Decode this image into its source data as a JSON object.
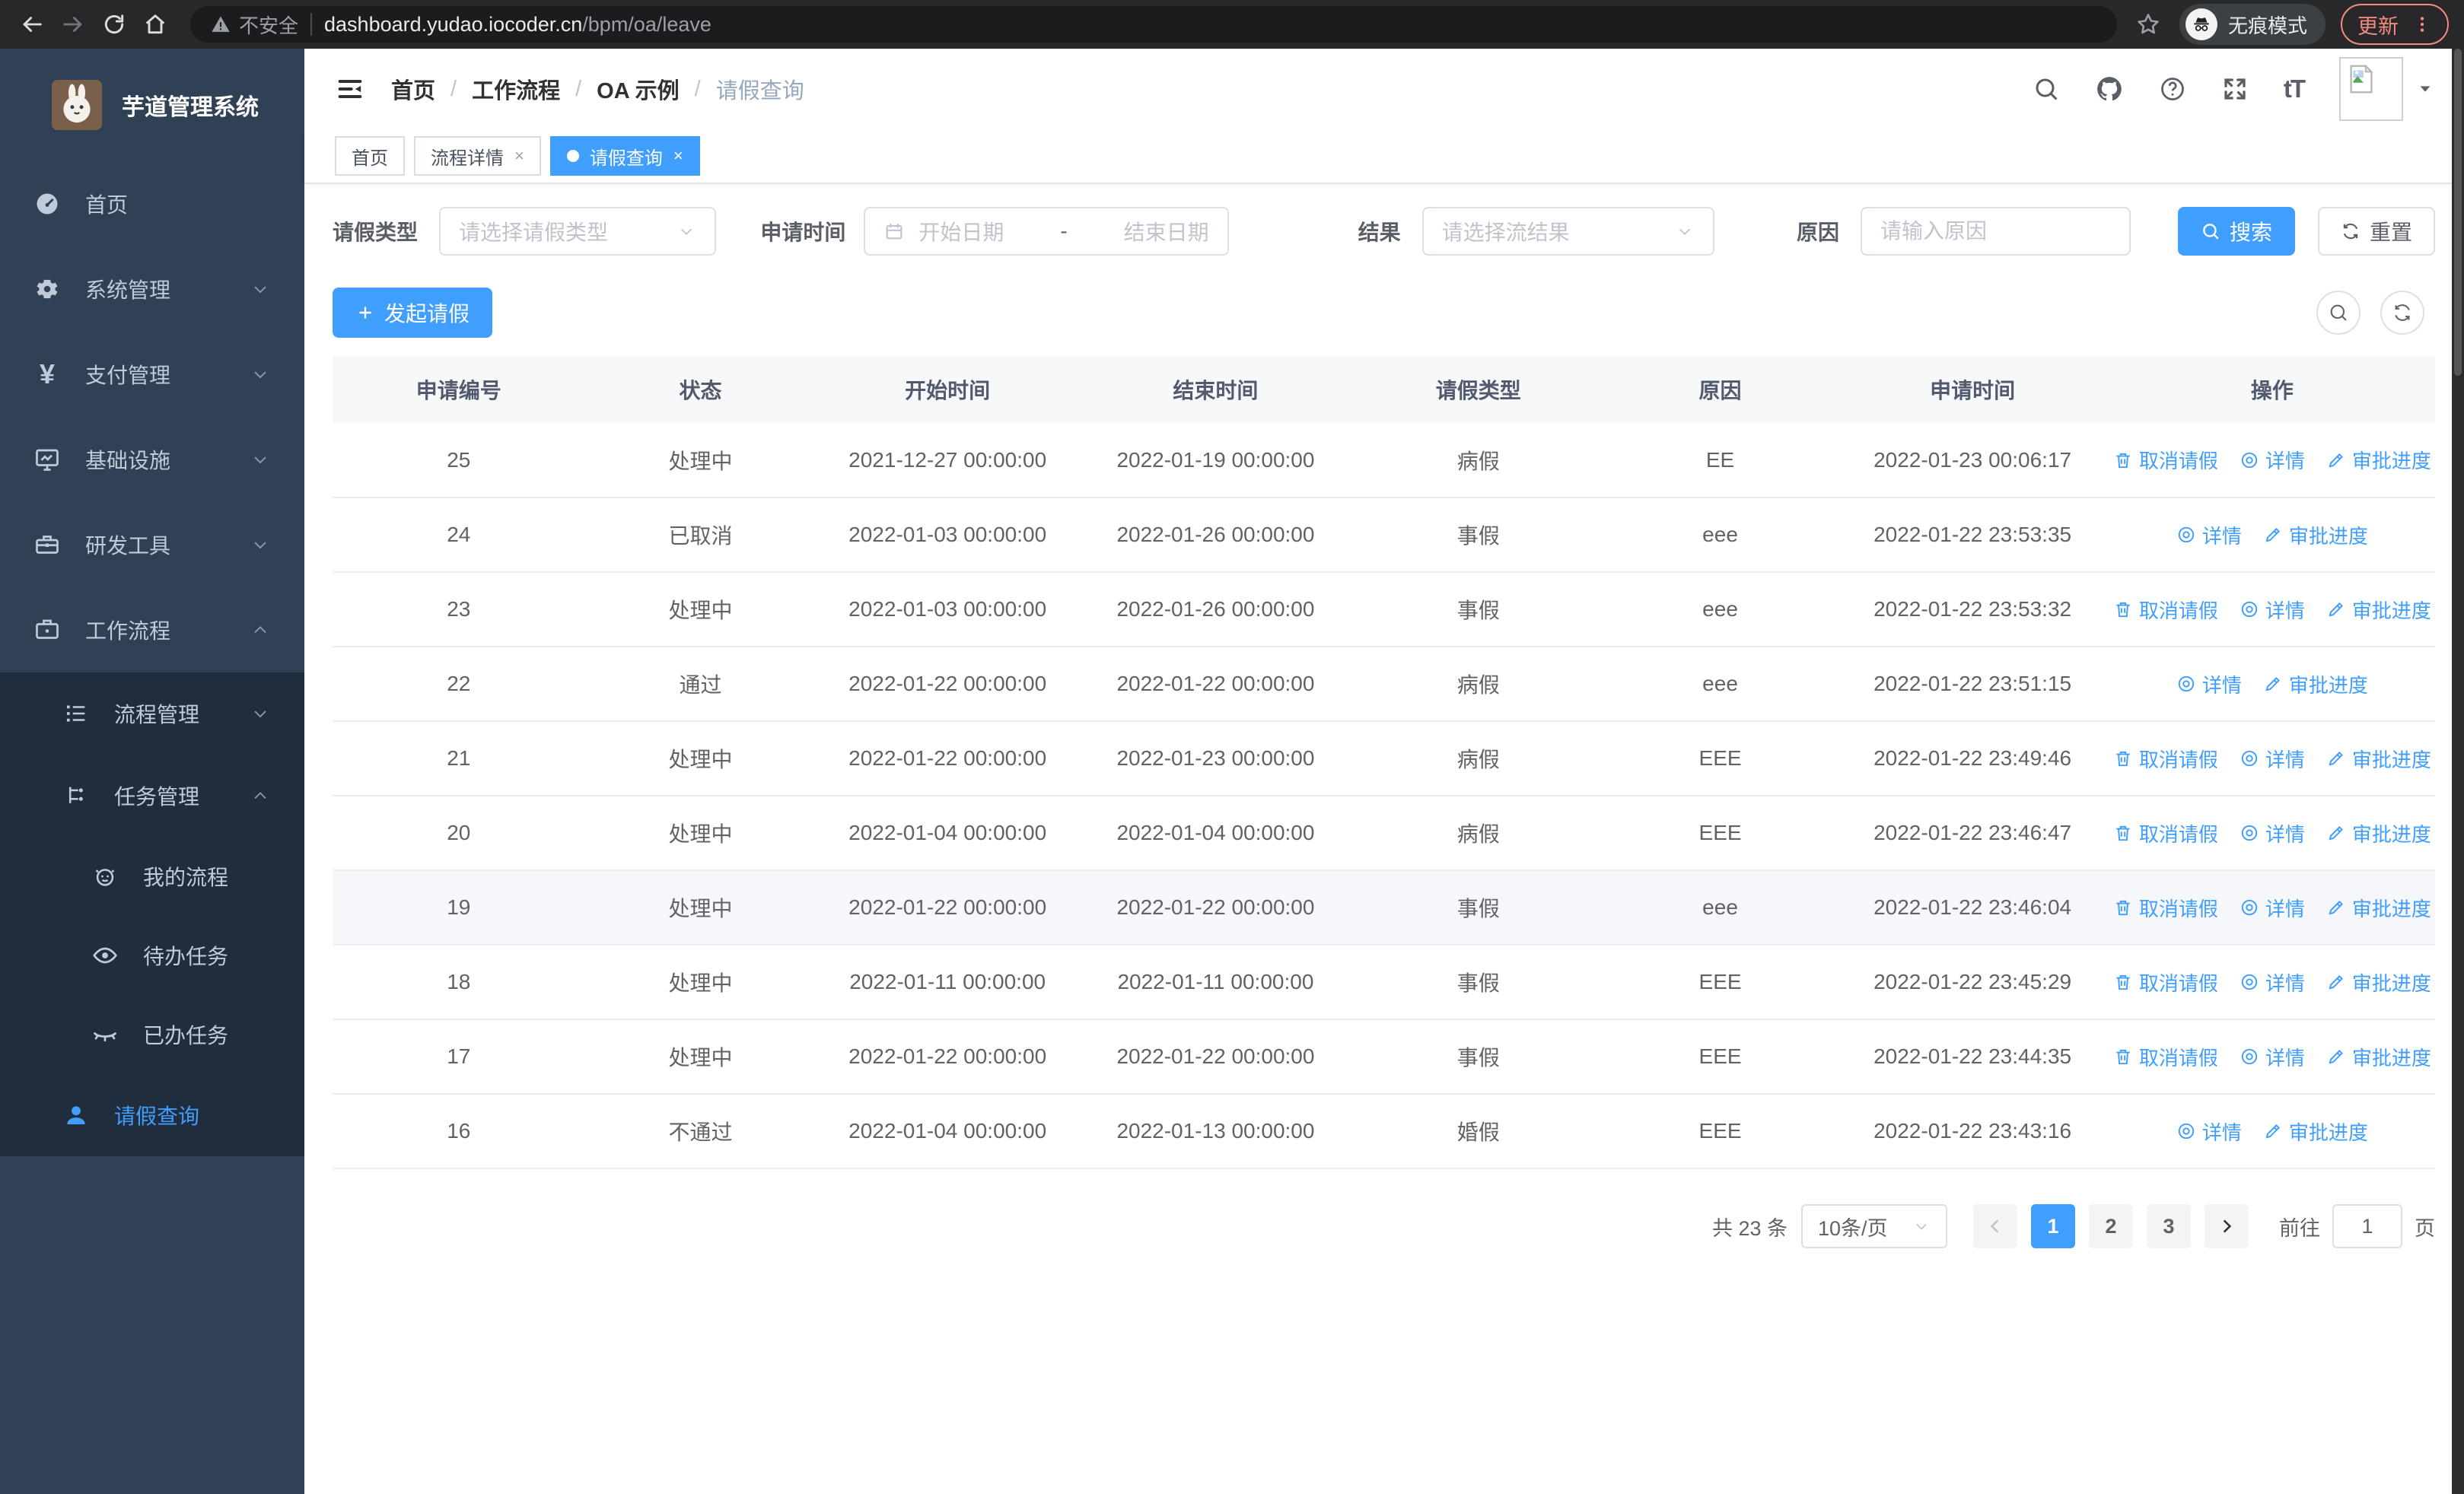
{
  "browser": {
    "security_label": "不安全",
    "url_domain": "dashboard.yudao.iocoder.cn",
    "url_path": "/bpm/oa/leave",
    "incognito_label": "无痕模式",
    "update_label": "更新"
  },
  "sidebar": {
    "title": "芋道管理系统",
    "items": [
      {
        "label": "首页",
        "icon": "dashboard-icon"
      },
      {
        "label": "系统管理",
        "icon": "gear-icon"
      },
      {
        "label": "支付管理",
        "icon": "yen-icon"
      },
      {
        "label": "基础设施",
        "icon": "monitor-icon"
      },
      {
        "label": "研发工具",
        "icon": "toolbox-icon"
      },
      {
        "label": "工作流程",
        "icon": "briefcase-icon"
      }
    ],
    "submenu": [
      {
        "label": "流程管理",
        "icon": "list-icon"
      },
      {
        "label": "任务管理",
        "icon": "flow-icon"
      }
    ],
    "tasks": [
      {
        "label": "我的流程",
        "icon": "face-icon"
      },
      {
        "label": "待办任务",
        "icon": "eye-icon"
      },
      {
        "label": "已办任务",
        "icon": "eye-closed-icon"
      },
      {
        "label": "请假查询",
        "icon": "user-icon",
        "active": true
      }
    ]
  },
  "header": {
    "breadcrumb": [
      "首页",
      "工作流程",
      "OA 示例",
      "请假查询"
    ]
  },
  "tabs": [
    {
      "label": "首页"
    },
    {
      "label": "流程详情"
    },
    {
      "label": "请假查询"
    }
  ],
  "filters": {
    "type_label": "请假类型",
    "type_placeholder": "请选择请假类型",
    "time_label": "申请时间",
    "start_placeholder": "开始日期",
    "range_separator": "-",
    "end_placeholder": "结束日期",
    "result_label": "结果",
    "result_placeholder": "请选择流结果",
    "reason_label": "原因",
    "reason_placeholder": "请输入原因",
    "search_label": "搜索",
    "reset_label": "重置"
  },
  "toolbar": {
    "create_label": "发起请假"
  },
  "table": {
    "columns": [
      "申请编号",
      "状态",
      "开始时间",
      "结束时间",
      "请假类型",
      "原因",
      "申请时间",
      "操作"
    ],
    "action_labels": {
      "cancel": "取消请假",
      "detail": "详情",
      "progress": "审批进度"
    },
    "rows": [
      {
        "id": "25",
        "status": "处理中",
        "start": "2021-12-27 00:00:00",
        "end": "2022-01-19 00:00:00",
        "type": "病假",
        "reason": "EE",
        "apply_time": "2022-01-23 00:06:17",
        "actions": [
          "cancel",
          "detail",
          "progress"
        ]
      },
      {
        "id": "24",
        "status": "已取消",
        "start": "2022-01-03 00:00:00",
        "end": "2022-01-26 00:00:00",
        "type": "事假",
        "reason": "eee",
        "apply_time": "2022-01-22 23:53:35",
        "actions": [
          "detail",
          "progress"
        ]
      },
      {
        "id": "23",
        "status": "处理中",
        "start": "2022-01-03 00:00:00",
        "end": "2022-01-26 00:00:00",
        "type": "事假",
        "reason": "eee",
        "apply_time": "2022-01-22 23:53:32",
        "actions": [
          "cancel",
          "detail",
          "progress"
        ]
      },
      {
        "id": "22",
        "status": "通过",
        "start": "2022-01-22 00:00:00",
        "end": "2022-01-22 00:00:00",
        "type": "病假",
        "reason": "eee",
        "apply_time": "2022-01-22 23:51:15",
        "actions": [
          "detail",
          "progress"
        ]
      },
      {
        "id": "21",
        "status": "处理中",
        "start": "2022-01-22 00:00:00",
        "end": "2022-01-23 00:00:00",
        "type": "病假",
        "reason": "EEE",
        "apply_time": "2022-01-22 23:49:46",
        "actions": [
          "cancel",
          "detail",
          "progress"
        ]
      },
      {
        "id": "20",
        "status": "处理中",
        "start": "2022-01-04 00:00:00",
        "end": "2022-01-04 00:00:00",
        "type": "病假",
        "reason": "EEE",
        "apply_time": "2022-01-22 23:46:47",
        "actions": [
          "cancel",
          "detail",
          "progress"
        ]
      },
      {
        "id": "19",
        "status": "处理中",
        "start": "2022-01-22 00:00:00",
        "end": "2022-01-22 00:00:00",
        "type": "事假",
        "reason": "eee",
        "apply_time": "2022-01-22 23:46:04",
        "actions": [
          "cancel",
          "detail",
          "progress"
        ],
        "highlight": true
      },
      {
        "id": "18",
        "status": "处理中",
        "start": "2022-01-11 00:00:00",
        "end": "2022-01-11 00:00:00",
        "type": "事假",
        "reason": "EEE",
        "apply_time": "2022-01-22 23:45:29",
        "actions": [
          "cancel",
          "detail",
          "progress"
        ]
      },
      {
        "id": "17",
        "status": "处理中",
        "start": "2022-01-22 00:00:00",
        "end": "2022-01-22 00:00:00",
        "type": "事假",
        "reason": "EEE",
        "apply_time": "2022-01-22 23:44:35",
        "actions": [
          "cancel",
          "detail",
          "progress"
        ]
      },
      {
        "id": "16",
        "status": "不通过",
        "start": "2022-01-04 00:00:00",
        "end": "2022-01-13 00:00:00",
        "type": "婚假",
        "reason": "EEE",
        "apply_time": "2022-01-22 23:43:16",
        "actions": [
          "detail",
          "progress"
        ]
      }
    ]
  },
  "pagination": {
    "total": "共 23 条",
    "page_size": "10条/页",
    "pages": [
      "1",
      "2",
      "3"
    ],
    "active_page": "1",
    "goto_label": "前往",
    "goto_value": "1",
    "page_unit": "页"
  },
  "colors": {
    "accent": "#409eff",
    "sidebar_bg": "#304156",
    "submenu_bg": "#1f2d3d",
    "update_badge": "#f28b82"
  }
}
